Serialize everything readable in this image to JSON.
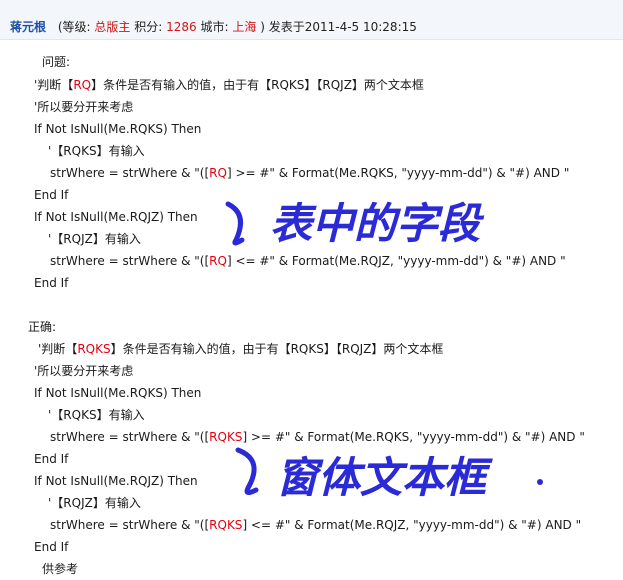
{
  "post": {
    "author": "蒋元根",
    "level_prefix": "(等级: ",
    "level": "总版主",
    "points_prefix": " 积分:",
    "points": "1286",
    "city_prefix": " 城市:",
    "city": "上海",
    "posted_suffix": ") 发表于2011-4-5 10:28:15"
  },
  "wrong": {
    "heading": "问题:",
    "comment1_a": "'判断【",
    "comment1_b": "RQ",
    "comment1_c": "】条件是否有输入的值，由于有【RQKS】【RQJZ】两个文本框",
    "comment2": "'所以要分开来考虑",
    "if1": "If Not IsNull(Me.RQKS) Then",
    "c_ks": "'【RQKS】有输入",
    "s1_a": "strWhere = strWhere & \"([",
    "s1_b": "RQ",
    "s1_c": "] >= #\" & Format(Me.RQKS, \"yyyy-mm-dd\") & \"#) AND \"",
    "endif1": "End If",
    "if2": "If Not IsNull(Me.RQJZ) Then",
    "c_jz": "'【RQJZ】有输入",
    "s2_a": "strWhere = strWhere & \"([",
    "s2_b": "RQ",
    "s2_c": "] <= #\" & Format(Me.RQJZ, \"yyyy-mm-dd\") & \"#) AND \"",
    "endif2": "End If"
  },
  "right": {
    "heading": "正确:",
    "comment1_a": "'判断【",
    "comment1_b": "RQKS",
    "comment1_c": "】条件是否有输入的值，由于有【RQKS】【RQJZ】两个文本框",
    "comment2": "'所以要分开来考虑",
    "if1": "If Not IsNull(Me.RQKS) Then",
    "c_ks": "'【RQKS】有输入",
    "s1_a": "strWhere = strWhere & \"([",
    "s1_b": "RQKS",
    "s1_c": "] >= #\" & Format(Me.RQKS, \"yyyy-mm-dd\") & \"#) AND \"",
    "endif1": "End If",
    "if2": "If Not IsNull(Me.RQJZ) Then",
    "c_jz": "'【RQJZ】有输入",
    "s2_a": "strWhere = strWhere & \"([",
    "s2_b": "RQKS",
    "s2_c": "] <= #\" & Format(Me.RQJZ, \"yyyy-mm-dd\") & \"#) AND \"",
    "endif2": "End If",
    "closing": "供参考"
  },
  "annotations": {
    "note1": "表中的字段",
    "note2": "窗体文本框",
    "ink_color": "#2a2ad6"
  },
  "colors": {
    "highlight": "#e60012",
    "author": "#1d4fa5"
  }
}
